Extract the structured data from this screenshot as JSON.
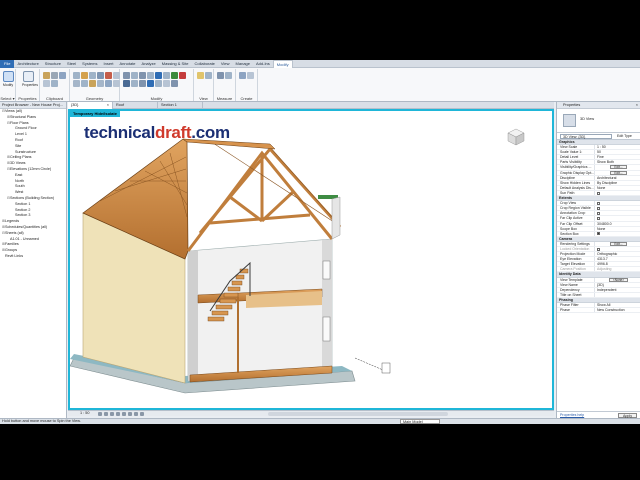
{
  "ribbon": {
    "tabs": [
      "File",
      "Architecture",
      "Structure",
      "Steel",
      "Systems",
      "Insert",
      "Annotate",
      "Analyze",
      "Massing & Site",
      "Collaborate",
      "View",
      "Manage",
      "Add-Ins",
      "Modify"
    ],
    "active_tab": "Modify",
    "modify_label": "Modify",
    "properties_label": "Properties",
    "panels": [
      "Select",
      "Properties",
      "Clipboard",
      "Geometry",
      "Modify",
      "View",
      "Measure",
      "Create"
    ],
    "select_dropdown": "Select ▾"
  },
  "browser": {
    "title": "Project Browser - New House Proj...",
    "items": [
      {
        "indent": 0,
        "toggle": "⊟",
        "label": "Views (all)"
      },
      {
        "indent": 1,
        "toggle": "⊞",
        "label": "Structural Plans"
      },
      {
        "indent": 1,
        "toggle": "⊟",
        "label": "Floor Plans"
      },
      {
        "indent": 2,
        "toggle": "",
        "label": "Ground Floor"
      },
      {
        "indent": 2,
        "toggle": "",
        "label": "Level 1"
      },
      {
        "indent": 2,
        "toggle": "",
        "label": "Roof"
      },
      {
        "indent": 2,
        "toggle": "",
        "label": "Site"
      },
      {
        "indent": 2,
        "toggle": "",
        "label": "Sunstructure"
      },
      {
        "indent": 1,
        "toggle": "⊞",
        "label": "Ceiling Plans"
      },
      {
        "indent": 1,
        "toggle": "⊞",
        "label": "3D Views"
      },
      {
        "indent": 1,
        "toggle": "⊟",
        "label": "Elevations (12mm Circle)"
      },
      {
        "indent": 2,
        "toggle": "",
        "label": "East"
      },
      {
        "indent": 2,
        "toggle": "",
        "label": "North"
      },
      {
        "indent": 2,
        "toggle": "",
        "label": "South"
      },
      {
        "indent": 2,
        "toggle": "",
        "label": "West"
      },
      {
        "indent": 1,
        "toggle": "⊟",
        "label": "Sections (Building Section)"
      },
      {
        "indent": 2,
        "toggle": "",
        "label": "Section 1"
      },
      {
        "indent": 2,
        "toggle": "",
        "label": "Section 2"
      },
      {
        "indent": 2,
        "toggle": "",
        "label": "Section 3"
      },
      {
        "indent": 0,
        "toggle": "⊞",
        "label": "Legends"
      },
      {
        "indent": 0,
        "toggle": "⊞",
        "label": "Schedules/Quantities (all)"
      },
      {
        "indent": 0,
        "toggle": "⊟",
        "label": "Sheets (all)"
      },
      {
        "indent": 1,
        "toggle": "",
        "label": "A1.01 - Unnamed"
      },
      {
        "indent": 0,
        "toggle": "⊞",
        "label": "Families"
      },
      {
        "indent": 0,
        "toggle": "⊞",
        "label": "Groups"
      },
      {
        "indent": 0,
        "toggle": "",
        "label": "Revit Links"
      }
    ]
  },
  "view_tabs": [
    {
      "label": "{3D}",
      "close": "×",
      "active": true
    },
    {
      "label": "Roof",
      "close": "",
      "active": false
    },
    {
      "label": "Section 1",
      "close": "",
      "active": false
    }
  ],
  "canvas": {
    "temp_label": "Temporary Hide/Isolate",
    "watermark_a": "technical",
    "watermark_b": "draft",
    "watermark_c": ".com",
    "scale": "1 : 50"
  },
  "properties": {
    "title": "Properties",
    "type_name": "3D View",
    "instance": "3D View: {3D}",
    "edit_type": "Edit Type",
    "sections": [
      {
        "group": "Graphics",
        "rows": [
          [
            "View Scale",
            "1 : 50",
            ""
          ],
          [
            "Scale Value  1:",
            "50",
            ""
          ],
          [
            "Detail Level",
            "Fine",
            ""
          ],
          [
            "Parts Visibility",
            "Show Both",
            ""
          ],
          [
            "Visibility/Graphics ...",
            "Edit...",
            "btn"
          ],
          [
            "Graphic Display Opt...",
            "Edit...",
            "btn"
          ],
          [
            "Discipline",
            "Architectural",
            ""
          ],
          [
            "Show Hidden Lines",
            "By Discipline",
            ""
          ],
          [
            "Default Analysis Dis...",
            "None",
            ""
          ],
          [
            "Sun Path",
            "",
            "cb"
          ]
        ]
      },
      {
        "group": "Extents",
        "rows": [
          [
            "Crop View",
            "",
            "cb"
          ],
          [
            "Crop Region Visible",
            "",
            "cb"
          ],
          [
            "Annotation Crop",
            "",
            "cb"
          ],
          [
            "Far Clip Active",
            "",
            "cb"
          ],
          [
            "Far Clip Offset",
            "304800.0",
            ""
          ],
          [
            "Scope Box",
            "None",
            ""
          ],
          [
            "Section Box",
            "",
            "cbon"
          ]
        ]
      },
      {
        "group": "Camera",
        "rows": [
          [
            "Rendering Settings",
            "Edit...",
            "btn"
          ],
          [
            "Locked Orientation",
            "",
            "dimcb"
          ],
          [
            "Projection Mode",
            "Orthographic",
            ""
          ],
          [
            "Eye Elevation",
            "4313.7",
            ""
          ],
          [
            "Target Elevation",
            "4996.8",
            ""
          ],
          [
            "Camera Position",
            "Adjusting",
            "dim"
          ]
        ]
      },
      {
        "group": "Identity Data",
        "rows": [
          [
            "View Template",
            "<None>",
            "btn"
          ],
          [
            "View Name",
            "{3D}",
            ""
          ],
          [
            "Dependency",
            "Independent",
            ""
          ],
          [
            "Title on Sheet",
            "",
            ""
          ]
        ]
      },
      {
        "group": "Phasing",
        "rows": [
          [
            "Phase Filter",
            "Show All",
            ""
          ],
          [
            "Phase",
            "New Construction",
            ""
          ]
        ]
      }
    ],
    "help_link": "Properties help",
    "apply": "Apply"
  },
  "status": {
    "text": "Hold button and move mouse to Spin the View.",
    "model": "Main Model"
  }
}
